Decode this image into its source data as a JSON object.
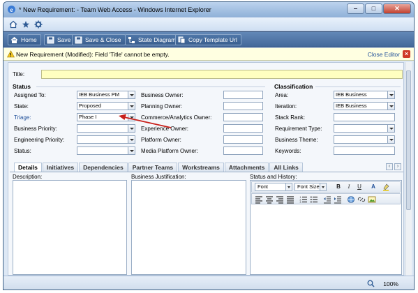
{
  "window": {
    "title": "* New Requirement: - Team Web Access - Windows Internet Explorer"
  },
  "toolbar": {
    "home": "Home",
    "save": "Save",
    "save_close": "Save & Close",
    "state_diagram": "State Diagram",
    "copy_template_url": "Copy Template Url"
  },
  "notification": {
    "message": "New Requirement (Modified): Field 'Title' cannot be empty.",
    "close_editor": "Close Editor"
  },
  "form": {
    "title_label": "Title:",
    "title_value": "",
    "status_header": "Status",
    "classification_header": "Classification",
    "status_fields": [
      {
        "label": "Assigned To:",
        "value": "IEB Business PM"
      },
      {
        "label": "State:",
        "value": "Proposed"
      },
      {
        "label": "Triage:",
        "value": "Phase I"
      },
      {
        "label": "Business Priority:",
        "value": ""
      },
      {
        "label": "Engineering Priority:",
        "value": ""
      },
      {
        "label": "Status:",
        "value": ""
      }
    ],
    "owner_fields": [
      {
        "label": "Business Owner:",
        "value": ""
      },
      {
        "label": "Planning Owner:",
        "value": ""
      },
      {
        "label": "Commerce/Analytics Owner:",
        "value": ""
      },
      {
        "label": "Experience Owner:",
        "value": ""
      },
      {
        "label": "Platform Owner:",
        "value": ""
      },
      {
        "label": "Media Platform Owner:",
        "value": ""
      }
    ],
    "classification_fields": [
      {
        "label": "Area:",
        "value": "IEB Business"
      },
      {
        "label": "Iteration:",
        "value": "IEB Business"
      },
      {
        "label": "Stack Rank:",
        "value": ""
      },
      {
        "label": "Requirement Type:",
        "value": ""
      },
      {
        "label": "Business Theme:",
        "value": ""
      },
      {
        "label": "Keywords:",
        "value": ""
      }
    ]
  },
  "tabs": [
    "Details",
    "Initiatives",
    "Dependencies",
    "Partner Teams",
    "Workstreams",
    "Attachments",
    "All Links"
  ],
  "details": {
    "description_label": "Description:",
    "business_justification_label": "Business Justification:",
    "status_history_label": "Status and History:",
    "font_placeholder": "Font",
    "font_size_placeholder": "Font Size",
    "bold": "B",
    "italic": "I",
    "underline": "U",
    "font_color": "A"
  },
  "statusbar": {
    "zoom": "100%"
  },
  "colors": {
    "toolbar": "#4f77a8",
    "link": "#1f4f99",
    "title_field": "#ffffc0",
    "annotation_arrow": "#c8201b"
  }
}
